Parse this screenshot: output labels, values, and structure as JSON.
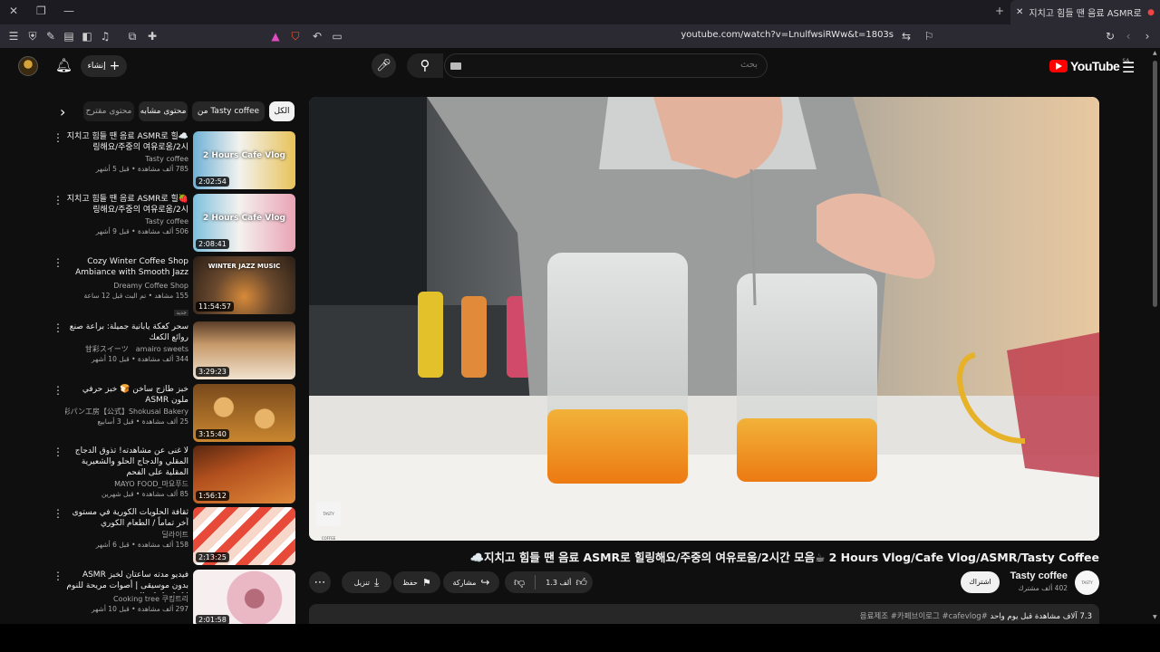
{
  "browser": {
    "tab_title": "지치고 힘들 땐 음료 ASMR로",
    "url": "youtube.com/watch?v=LnulfwsiRWw&t=1803s"
  },
  "header": {
    "logo_text": "YouTube",
    "logo_country": "SA",
    "search_placeholder": "بحث",
    "create_label": "إنشاء"
  },
  "chips": [
    {
      "label": "الكل",
      "active": true
    },
    {
      "label": "من Tasty coffee",
      "active": false
    },
    {
      "label": "محتوى مشابه",
      "active": false
    },
    {
      "label": "محتوى مقترح",
      "active": false
    }
  ],
  "related": [
    {
      "title": "☁️지치고 힘들 땐 음료 ASMR로 힐링해요/주중의 여유로움/2시",
      "channel": "Tasty coffee",
      "views": "785 ألف مشاهدة • قبل 5 أشهر",
      "duration": "2:02:54",
      "overlay": "2 Hours Cafe Vlog",
      "colors": [
        "#6fb1d6",
        "#e8c25a",
        "#f2f2ee"
      ]
    },
    {
      "title": "🍓지치고 힘들 땐 음료 ASMR로 힐링해요/주중의 여유로움/2시",
      "channel": "Tasty coffee",
      "views": "506 ألف مشاهدة • قبل 9 أشهر",
      "duration": "2:08:41",
      "overlay": "2 Hours Cafe Vlog",
      "colors": [
        "#e9a3b5",
        "#7cc0dd",
        "#f4f1ee"
      ]
    },
    {
      "title": "Cozy Winter Coffee Shop Ambiance with Smooth Jazz ...",
      "channel": "Dreamy Coffee Shop",
      "views": "155 مشاهد • تم البث قبل 12 ساعة",
      "duration": "11:54:57",
      "badge": "جديد",
      "overlay": "WINTER JAZZ MUSIC",
      "colors": [
        "#3a2a1e",
        "#d88a3a",
        "#6b4a2e"
      ]
    },
    {
      "title": "سحر كعكة يابانية جميلة: براعة صنع روائع الكعك",
      "channel": "甘彩スイーツ　amairo sweets",
      "views": "344 ألف مشاهدة • قبل 10 أشهر",
      "duration": "3:29:23",
      "overlay": "",
      "colors": [
        "#c79a6a",
        "#f0e2cf",
        "#5a3d28"
      ]
    },
    {
      "title": "خبز طازج ساخن 🍞 خبز حرفي ملون ASMR",
      "channel": "食彩パン工房【公式】Shokusai Bakery ...",
      "views": "25 ألف مشاهدة • قبل 3 أسابيع",
      "duration": "3:15:40",
      "overlay": "",
      "colors": [
        "#c9862f",
        "#7a4a1c",
        "#e8b46a"
      ]
    },
    {
      "title": "لا غنى عن مشاهدته! تذوق الدجاج المقلي والدجاج الحلو والشعيرية المقلية على الفحم",
      "channel": "MAYO FOOD_마요푸드",
      "views": "85 ألف مشاهدة • قبل شهرين",
      "duration": "1:56:12",
      "overlay": "",
      "colors": [
        "#b3501e",
        "#e08a3a",
        "#5a2810"
      ]
    },
    {
      "title": "ثقافة الحلويات الكورية في مستوى آخر تماماً / الطعام الكوري",
      "channel": "딜라이트",
      "views": "158 ألف مشاهدة • قبل 6 أشهر",
      "duration": "2:13:25",
      "overlay": "",
      "colors": [
        "#e84a3a",
        "#f6d7c9",
        "#ffffff"
      ]
    },
    {
      "title": "فيديو مدته ساعتان لخبز ASMR بدون موسيقى | أصوات مريحة للنوم | كعكة كعكة الجبن",
      "channel": "Cooking tree 쿠킹트리",
      "views": "297 ألف مشاهدة • قبل 10 أشهر",
      "duration": "2:01:58",
      "overlay": "",
      "colors": [
        "#e9b8c4",
        "#f7eef0",
        "#b56b7a"
      ]
    }
  ],
  "video": {
    "title": "☁️지치고 힘들 땐 음료 ASMR로 힐링해요/주중의 여유로움/2시간 모음☕ 2 Hours Vlog/Cafe Vlog/ASMR/Tasty Coffee",
    "watermark": "TASTY COFFEE",
    "channel_name": "Tasty coffee",
    "channel_subs": "402 ألف مشترك",
    "subscribe_label": "اشتراك",
    "likes": "1.3 ألف",
    "share_label": "مشاركة",
    "save_label": "حفظ",
    "download_label": "تنزيل",
    "views_date": "7.3 آلاف مشاهدة قبل يوم واحد",
    "hashtags": "#음료제조 #카페브이로그 #cafevlog"
  },
  "colors": {
    "background": "#0f0f0f",
    "brand_red": "#ff0000",
    "chip_bg": "#272727"
  }
}
